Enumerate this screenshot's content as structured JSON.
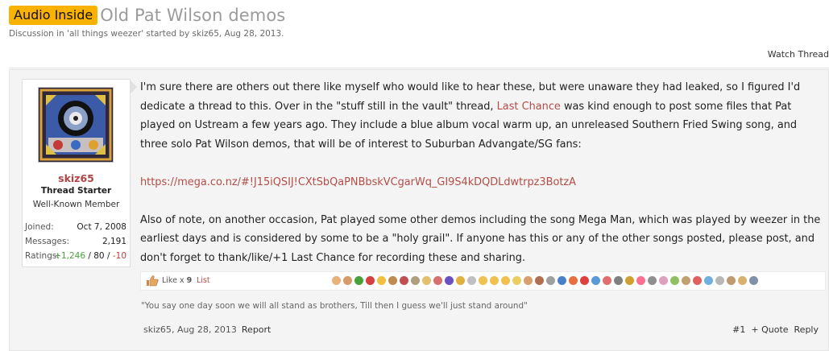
{
  "thread": {
    "prefix": "Audio Inside",
    "title": "Old Pat Wilson demos",
    "description": "Discussion in 'all things weezer' started by skiz65, Aug 28, 2013.",
    "watch_label": "Watch Thread"
  },
  "user": {
    "name": "skiz65",
    "title": "Thread Starter",
    "banner": "Well-Known Member",
    "joined_label": "Joined:",
    "joined_value": "Oct 7, 2008",
    "messages_label": "Messages:",
    "messages_value": "2,191",
    "ratings_label": "Ratings:",
    "ratings_pos": "+1,246",
    "ratings_sep1": " / ",
    "ratings_neutral": "80",
    "ratings_sep2": " / ",
    "ratings_neg": "-10"
  },
  "post": {
    "p1_a": "I'm sure there are others out there like myself who would like to hear these, but were unaware they had leaked, so I figured I'd dedicate a thread to this. Over in the \"stuff still in the vault\" thread, ",
    "p1_link": "Last Chance",
    "p1_b": " was kind enough to post some files that Pat played on Ustream a few years ago. They include a blue album vocal warm up, an unreleased Southern Fried Swing song, and three solo Pat Wilson demos, that will be of interest to Suburban Advangate/SG fans:",
    "url": "https://mega.co.nz/#!J15iQSIJ!CXtSbQaPNBbskVCgarWq_GI9S4kDQDLdwtrpz3BotzA",
    "p2": "Also of note, on another occasion, Pat played some other demos including the song Mega Man, which was played by weezer in the earliest days and is considered by some to be a \"holy grail\". If anyone has this or any of the other songs posted, please post, and don't forget to thank/like/+1 Last Chance for recording these and sharing.",
    "like_text": "Like x ",
    "like_count": "9",
    "list_label": "List",
    "signature": "\"You say one day soon we will all stand as brothers, Till then I guess we'll just stand around\"",
    "author": "skiz65",
    "date": "Aug 28, 2013",
    "report_label": "Report",
    "post_number": "#1",
    "quote_label": "+ Quote",
    "reply_label": "Reply"
  },
  "colors": {
    "prefix_bg": "#f9b200",
    "link": "#b44d47",
    "username": "#b04444",
    "rating_positive": "#48a23a",
    "rating_negative": "#c63b3b"
  },
  "icons": {
    "like": "thumbs-up-icon",
    "rating_bar": "rating-icons"
  }
}
